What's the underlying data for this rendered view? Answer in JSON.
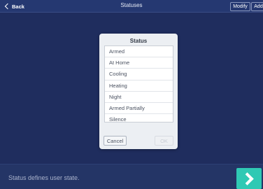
{
  "nav": {
    "back_label": "Back",
    "title": "Statuses",
    "modify_label": "Modify",
    "add_label": "Add"
  },
  "dialog": {
    "title": "Status",
    "items": [
      "Armed",
      "At Home",
      "Cooling",
      "Heating",
      "Night",
      "Armed Partially",
      "Silence"
    ],
    "cancel_label": "Cancel",
    "ok_label": "OK"
  },
  "footer": {
    "caption": "Status defines user state."
  },
  "icons": {
    "back": "chevron-left-icon",
    "next": "chevron-right-icon"
  },
  "colors": {
    "background": "#1f2d5e",
    "accent": "#2fc9b4"
  }
}
